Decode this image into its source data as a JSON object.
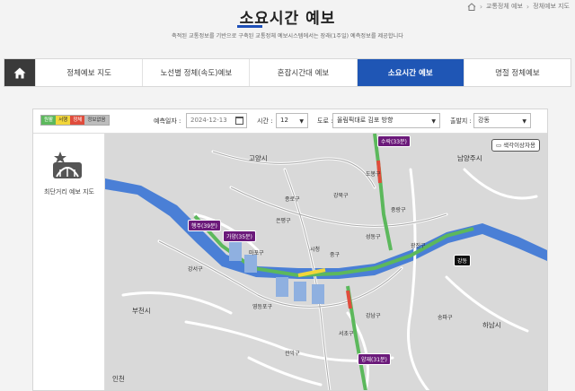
{
  "breadcrumb": {
    "items": [
      "교통정체 예보",
      "정체예보 지도"
    ]
  },
  "header": {
    "title": "소요시간 예보",
    "subtitle": "축적된 교통정보를 기반으로 구축된 교통정체 예보시스템에서는 장래(1주일) 예측정보를 제공합니다"
  },
  "tabs": [
    {
      "label": "정체예보 지도"
    },
    {
      "label": "노선별 정체(속도)예보"
    },
    {
      "label": "혼잡시간대 예보"
    },
    {
      "label": "소요시간 예보",
      "active": true
    },
    {
      "label": "명절 정체예보"
    }
  ],
  "legend": [
    "원활",
    "서행",
    "정체",
    "정보없음"
  ],
  "colors": {
    "accent": "#1f56b5",
    "green": "#5cb85c",
    "yellow": "#f2d63a",
    "red": "#e04c3c",
    "tag": "#6b1a7a"
  },
  "filters": {
    "date_label": "예측일자 :",
    "date_value": "2024-12-13",
    "time_label": "시간 :",
    "time_value": "12",
    "road_label": "도로 :",
    "road_value": "올림픽대로 김포 방향",
    "origin_label": "출발지 :",
    "origin_value": "강동"
  },
  "sidebar": {
    "icon": "shortest-route-map-icon",
    "label": "최단거리 예보 지도"
  },
  "map": {
    "color_button": "색각이상자용",
    "tags": {
      "susak": "수락(33분)",
      "haengju": "행주(39분)",
      "gayang": "가양(35분)",
      "gangdong": "강동",
      "yangjae": "양재(31분)"
    },
    "cities": {
      "goyang": "고양시",
      "namyangju": "남양주시",
      "bucheon": "부천시",
      "hanam": "하남시",
      "incheon": "인천"
    },
    "places": {
      "gangseo": "강서구",
      "jongno": "종로구",
      "gangbuk": "강북구",
      "seoul_station": "시청",
      "junggu": "중구",
      "gangnam": "강남구",
      "eunpyeong": "은평구",
      "jungnang": "중랑구",
      "seongdong": "성동구",
      "gwangjin": "광진구",
      "songpa": "송파구",
      "yeongdeungpo": "영등포구",
      "seocho": "서초구",
      "gwanak": "관악구",
      "mapo": "마포구",
      "dobong": "도봉구"
    }
  }
}
